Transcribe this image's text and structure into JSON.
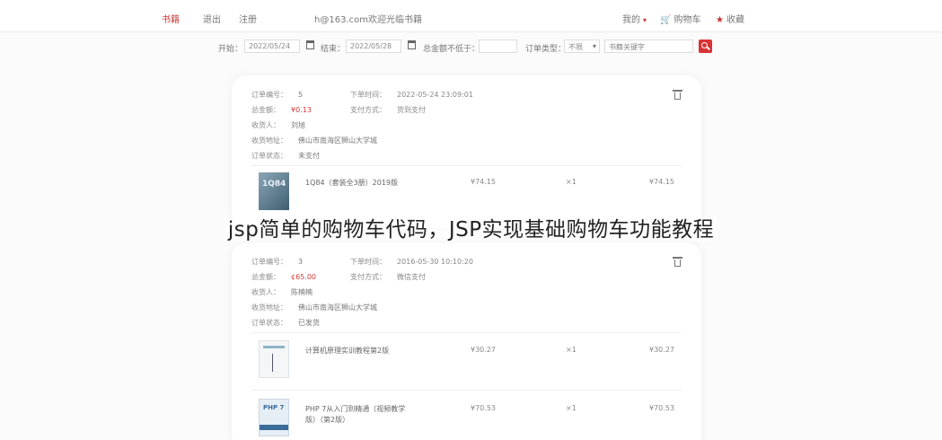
{
  "topbar": {
    "home": "书籍",
    "logout": "退出",
    "register": "注册",
    "user": "h@163.com欢迎光临书籍",
    "mine": "我的",
    "cart": "购物车",
    "fav": "收藏"
  },
  "filter": {
    "start_label": "开始：",
    "start_value": "2022/05/24",
    "end_label": "结束：",
    "end_value": "2022/05/28",
    "amount_label": "总金额不低于：",
    "amount_value": "",
    "type_label": "订单类型：",
    "type_value": "不限",
    "keyword_placeholder": "书籍关键字"
  },
  "orders": [
    {
      "id_label": "订单编号：",
      "id": "5",
      "time_label": "下单时间：",
      "time": "2022-05-24 23:09:01",
      "total_label": "总金额：",
      "total": "¥0.13",
      "pay_label": "支付方式：",
      "pay": "货到支付",
      "receiver_label": "收货人：",
      "receiver": "刘旭",
      "addr_label": "收货地址：",
      "addr": "佛山市南海区狮山大学城",
      "status_label": "订单状态：",
      "status": "未支付",
      "items": [
        {
          "name": "1Q84（套装全3册）2019版",
          "price": "¥74.15",
          "qty": "×1",
          "subtotal": "¥74.15",
          "cover": "1Q84"
        }
      ]
    },
    {
      "id_label": "订单编号：",
      "id": "3",
      "time_label": "下单时间：",
      "time": "2016-05-30 10:10:20",
      "total_label": "总金额：",
      "total": "¢65.00",
      "pay_label": "支付方式：",
      "pay": "微信支付",
      "receiver_label": "收货人：",
      "receiver": "陈楠楠",
      "addr_label": "收货地址：",
      "addr": "佛山市南海区狮山大学城",
      "status_label": "订单状态：",
      "status": "已发货",
      "items": [
        {
          "name": "计算机原理实训教程第2版",
          "price": "¥30.27",
          "qty": "×1",
          "subtotal": "¥30.27"
        },
        {
          "name": "PHP 7从入门到精通（视频教学版）（第2版）",
          "price": "¥70.53",
          "qty": "×1",
          "subtotal": "¥70.53",
          "cover": "PHP 7"
        }
      ]
    }
  ],
  "watermark": "jsp简单的购物车代码，JSP实现基础购物车功能教程",
  "colors": {
    "accent": "#d83232",
    "card_bg": "#ffffff",
    "page_bg": "#fbfbfb"
  }
}
